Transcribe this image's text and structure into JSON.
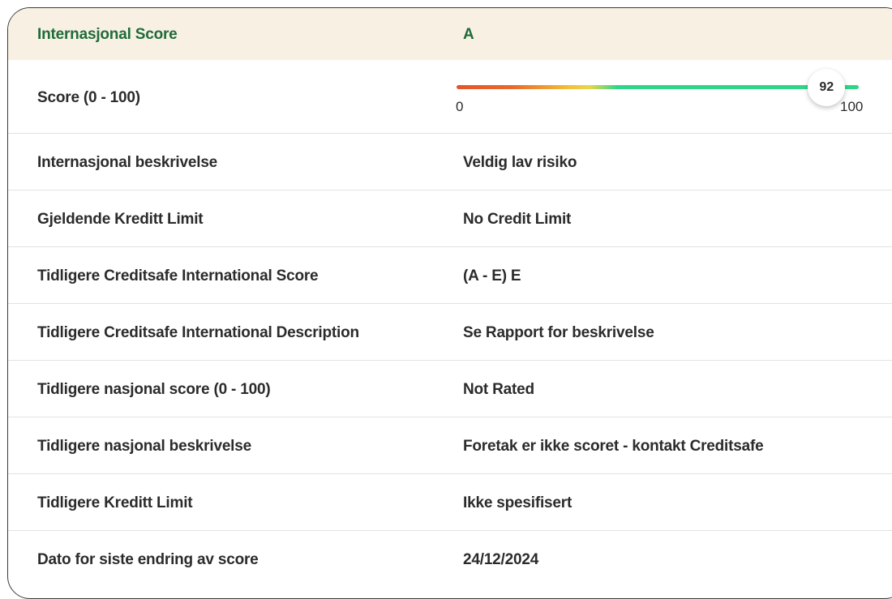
{
  "header": {
    "label": "Internasjonal Score",
    "value": "A"
  },
  "score": {
    "label": "Score (0 - 100)",
    "value": "92",
    "min": "0",
    "max": "100",
    "fraction": 0.92
  },
  "rows": [
    {
      "label": "Internasjonal beskrivelse",
      "value": "Veldig lav risiko"
    },
    {
      "label": "Gjeldende Kreditt Limit",
      "value": "No Credit Limit"
    },
    {
      "label": "Tidligere Creditsafe International Score",
      "value": "(A - E) E"
    },
    {
      "label": "Tidligere Creditsafe International Description",
      "value": "Se Rapport for beskrivelse"
    },
    {
      "label": "Tidligere nasjonal score (0 - 100)",
      "value": "Not Rated"
    },
    {
      "label": "Tidligere nasjonal beskrivelse",
      "value": "Foretak er ikke scoret - kontakt Creditsafe"
    },
    {
      "label": "Tidligere Kreditt Limit",
      "value": "Ikke spesifisert"
    },
    {
      "label": "Dato for siste endring av score",
      "value": "24/12/2024"
    }
  ],
  "colors": {
    "header_bg": "#f8f1e3",
    "header_text": "#1f6b3a",
    "bar_low": "#e4542b",
    "bar_mid": "#f2c03a",
    "bar_high": "#2fd68a"
  }
}
